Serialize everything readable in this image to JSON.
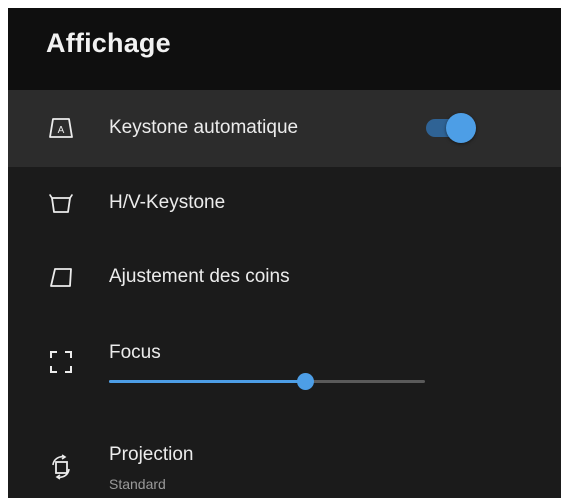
{
  "header": {
    "title": "Affichage"
  },
  "menu": {
    "items": [
      {
        "label": "Keystone automatique",
        "icon": "auto-keystone-icon",
        "icon_text": "A",
        "toggle_on": true,
        "selected": true
      },
      {
        "label": "H/V-Keystone",
        "icon": "hv-keystone-icon"
      },
      {
        "label": "Ajustement des coins",
        "icon": "corner-adjust-icon"
      },
      {
        "label": "Focus",
        "icon": "focus-icon",
        "slider_value": 0.62
      },
      {
        "label": "Projection",
        "icon": "projection-icon",
        "value": "Standard"
      }
    ]
  },
  "colors": {
    "accent": "#4d9ee6",
    "background": "#1b1b1b",
    "header_background": "#0f0f0f",
    "selected_row": "#2c2c2c"
  }
}
